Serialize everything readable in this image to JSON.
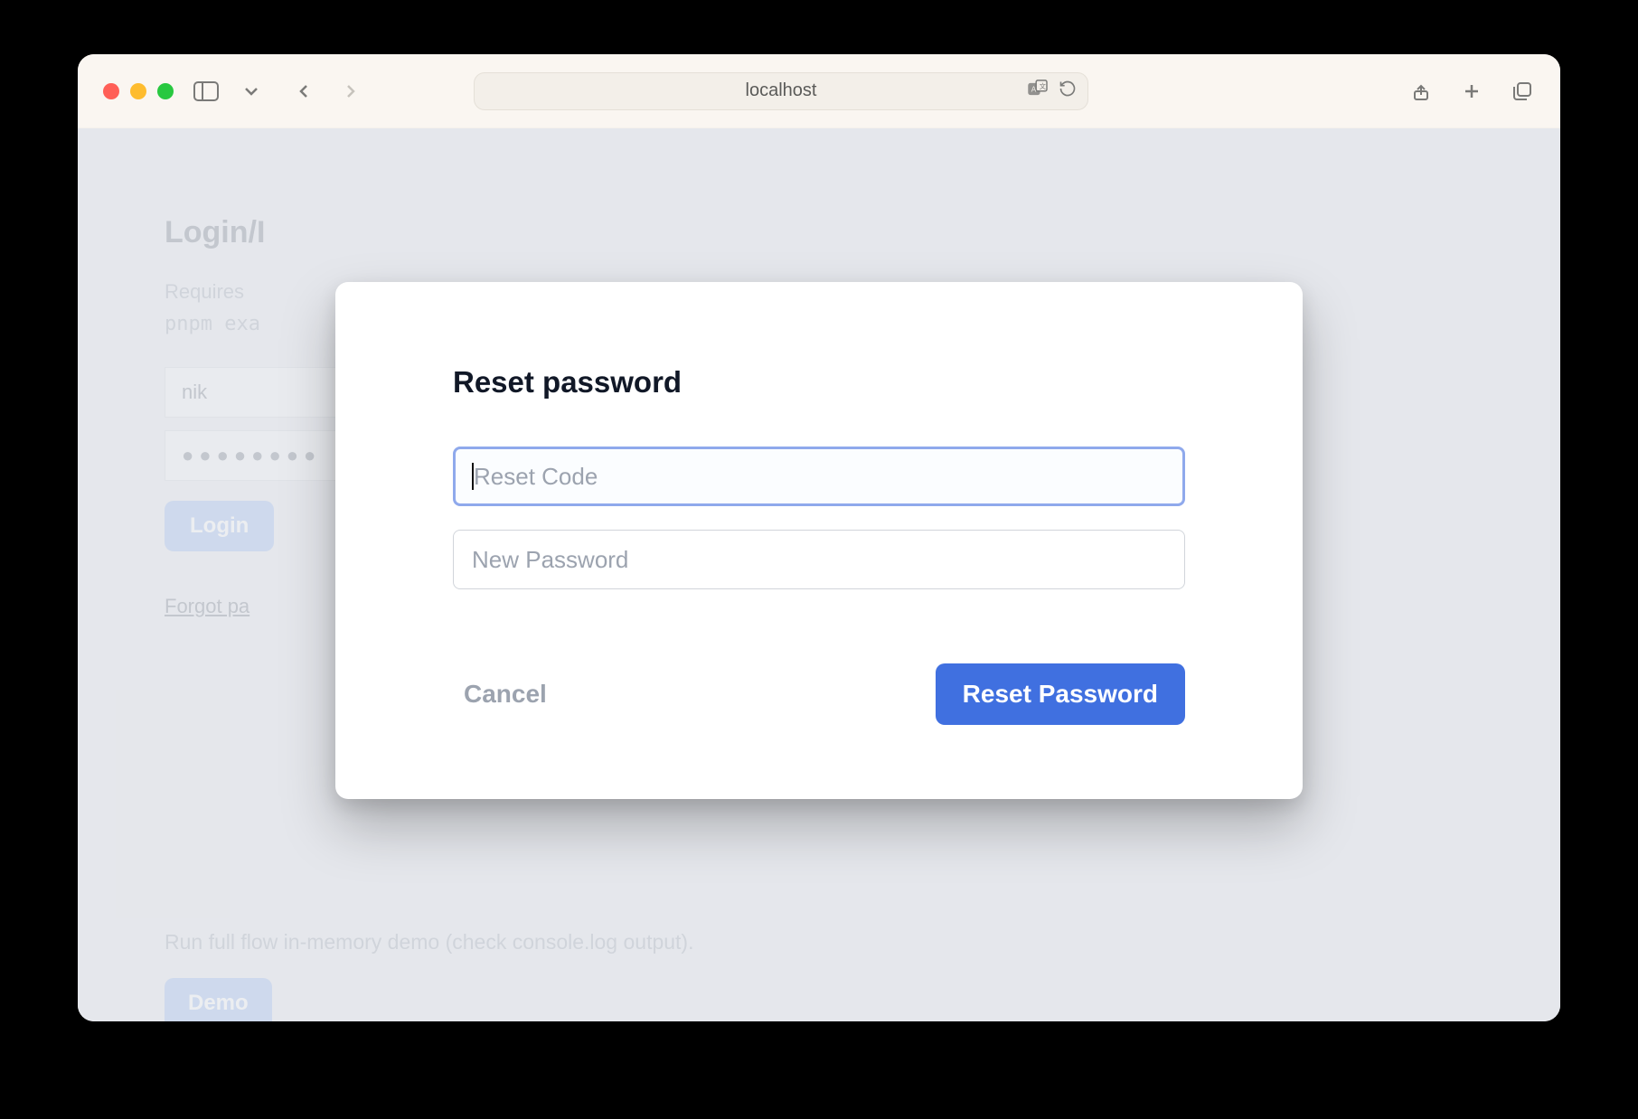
{
  "browser": {
    "address": "localhost"
  },
  "page": {
    "title_visible": "Login/I",
    "requires_prefix": "Requires",
    "code_prefix": "pnpm exa",
    "username_value": "nik",
    "password_masked": "●●●●●●●●",
    "login_button": "Login",
    "forgot_link_visible": "Forgot pa",
    "demo_text": "Run full flow in-memory demo (check console.log output).",
    "demo_button": "Demo"
  },
  "modal": {
    "title": "Reset password",
    "reset_code_placeholder": "Reset Code",
    "reset_code_value": "",
    "new_password_placeholder": "New Password",
    "new_password_value": "",
    "cancel_label": "Cancel",
    "submit_label": "Reset Password"
  }
}
